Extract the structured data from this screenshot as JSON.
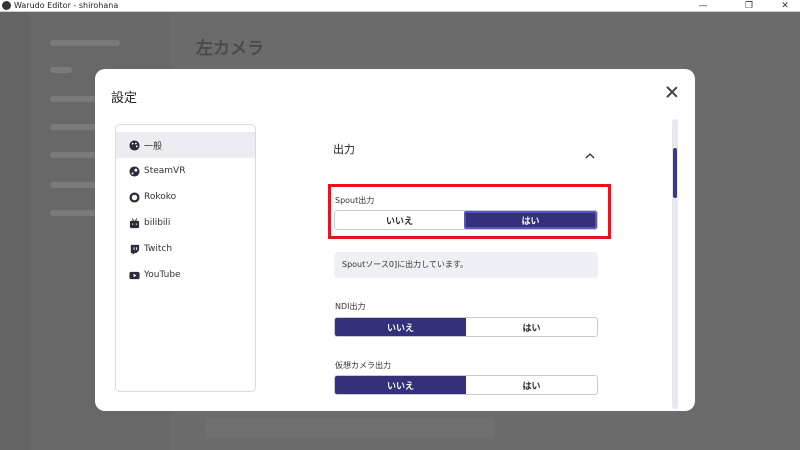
{
  "window": {
    "title": "Warudo Editor - shirohana",
    "minimize": "—",
    "restore": "❐",
    "close": "✕"
  },
  "background": {
    "page_title": "左カメラ"
  },
  "modal": {
    "title": "設定",
    "close_icon": "close-icon",
    "nav": [
      {
        "label": "一般",
        "icon": "palette-icon",
        "active": true
      },
      {
        "label": "SteamVR",
        "icon": "steamvr-icon",
        "active": false
      },
      {
        "label": "Rokoko",
        "icon": "rokoko-icon",
        "active": false
      },
      {
        "label": "bilibili",
        "icon": "bilibili-icon",
        "active": false
      },
      {
        "label": "Twitch",
        "icon": "twitch-icon",
        "active": false
      },
      {
        "label": "YouTube",
        "icon": "youtube-icon",
        "active": false
      }
    ],
    "section": {
      "title": "出力",
      "collapse_icon": "chevron-up-icon"
    },
    "spout": {
      "label": "Spout出力",
      "no": "いいえ",
      "yes": "はい",
      "selected": "yes"
    },
    "spout_info": "Spoutソース0]に出力しています。",
    "ndi": {
      "label": "NDI出力",
      "no": "いいえ",
      "yes": "はい",
      "selected": "no"
    },
    "virtual_camera": {
      "label": "仮想カメラ出力",
      "no": "いいえ",
      "yes": "はい",
      "selected": "no"
    }
  },
  "colors": {
    "accent": "#34307a",
    "highlight": "#e8141b"
  }
}
